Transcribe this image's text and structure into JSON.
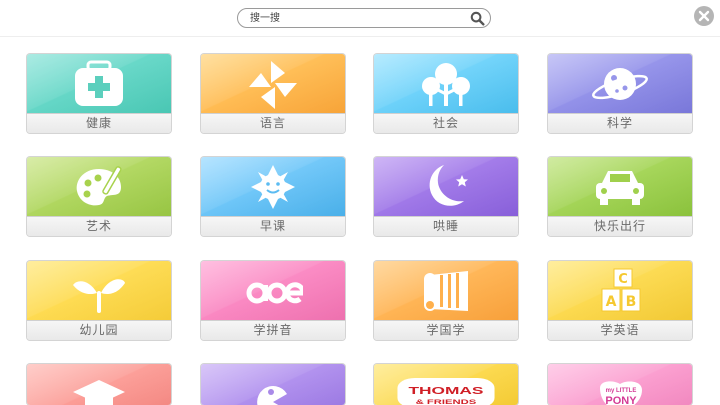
{
  "search": {
    "placeholder": "搜一搜"
  },
  "tiles": [
    {
      "label": "健康",
      "color_a": "#7ee0d4",
      "color_b": "#4ccdb9",
      "icon": "medical-kit-icon"
    },
    {
      "label": "语言",
      "color_a": "#ffcf6e",
      "color_b": "#ffa93a",
      "icon": "pinwheel-icon"
    },
    {
      "label": "社会",
      "color_a": "#8fe0ff",
      "color_b": "#4cc3f4",
      "icon": "trees-icon"
    },
    {
      "label": "科学",
      "color_a": "#a9a8f2",
      "color_b": "#7d7be0",
      "icon": "planet-icon"
    },
    {
      "label": "艺术",
      "color_a": "#c4e27a",
      "color_b": "#9ccb45",
      "icon": "palette-icon"
    },
    {
      "label": "早课",
      "color_a": "#8fd6ff",
      "color_b": "#4cb5f0",
      "icon": "sun-icon"
    },
    {
      "label": "哄睡",
      "color_a": "#b48ff0",
      "color_b": "#8c62e0",
      "icon": "moon-star-icon"
    },
    {
      "label": "快乐出行",
      "color_a": "#b8e070",
      "color_b": "#8fc83e",
      "icon": "car-icon"
    },
    {
      "label": "幼儿园",
      "color_a": "#ffe46a",
      "color_b": "#fcd23a",
      "icon": "sprout-icon"
    },
    {
      "label": "学拼音",
      "color_a": "#ff9dd0",
      "color_b": "#f574b4",
      "icon": "aoe-icon"
    },
    {
      "label": "学国学",
      "color_a": "#ffc46e",
      "color_b": "#ffa53c",
      "icon": "scroll-icon"
    },
    {
      "label": "学英语",
      "color_a": "#ffe46a",
      "color_b": "#f9cf36",
      "icon": "abc-blocks-icon"
    },
    {
      "label": "",
      "color_a": "#ffb3ad",
      "color_b": "#f98c86",
      "icon": "graduation-cap-icon"
    },
    {
      "label": "",
      "color_a": "#c4a8f5",
      "color_b": "#a07de8",
      "icon": "pacman-icon"
    },
    {
      "label": "THOMAS & FRIENDS",
      "color_a": "#ffe46a",
      "color_b": "#f9cf36",
      "icon": "thomas-logo"
    },
    {
      "label": "MY LITTLE PONY",
      "color_a": "#ffb3dc",
      "color_b": "#f78cc4",
      "icon": "my-little-pony-logo"
    }
  ]
}
